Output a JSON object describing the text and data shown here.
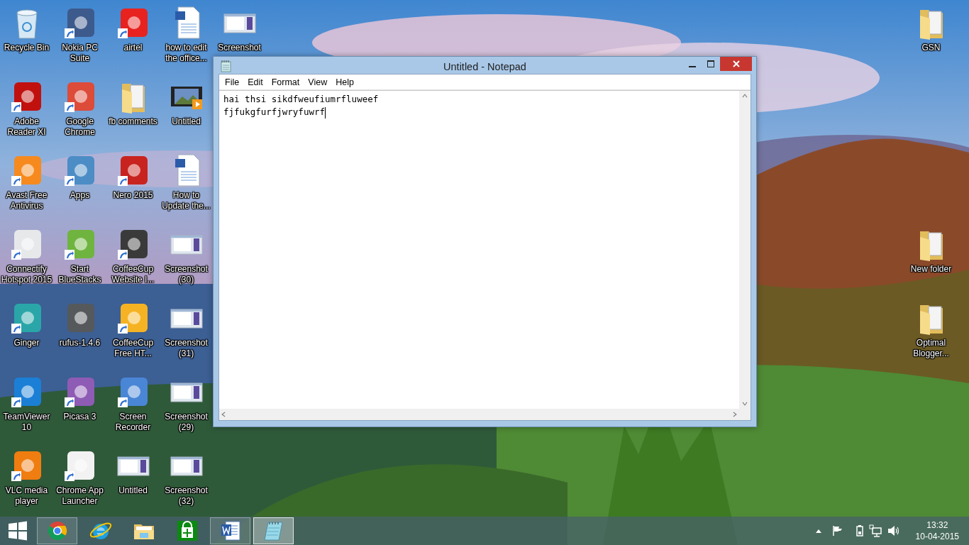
{
  "desktop": {
    "icon_columns": [
      [
        {
          "label": "Recycle Bin",
          "kind": "bin",
          "shortcut": false
        },
        {
          "label": "Adobe Reader XI",
          "kind": "app",
          "color": "#c1110f",
          "shortcut": true
        },
        {
          "label": "Avast Free Antivirus",
          "kind": "app",
          "color": "#f68a1e",
          "shortcut": true
        },
        {
          "label": "Connectify Hotspot 2015",
          "kind": "app",
          "color": "#e6e8ea",
          "shortcut": true
        },
        {
          "label": "Ginger",
          "kind": "app",
          "color": "#2aa6a8",
          "shortcut": true
        },
        {
          "label": "TeamViewer 10",
          "kind": "app",
          "color": "#1b7fd6",
          "shortcut": true
        },
        {
          "label": "VLC media player",
          "kind": "app",
          "color": "#f07d10",
          "shortcut": true
        }
      ],
      [
        {
          "label": "Nokia PC Suite",
          "kind": "app",
          "color": "#3d5a8c",
          "shortcut": true
        },
        {
          "label": "Google Chrome",
          "kind": "app",
          "color": "#dd4b39",
          "shortcut": true
        },
        {
          "label": "Apps",
          "kind": "app",
          "color": "#4c8dc6",
          "shortcut": true
        },
        {
          "label": "Start BlueStacks",
          "kind": "app",
          "color": "#6fb43f",
          "shortcut": true
        },
        {
          "label": "rufus-1.4.6",
          "kind": "app",
          "color": "#55595c",
          "shortcut": false
        },
        {
          "label": "Picasa 3",
          "kind": "app",
          "color": "#8e5bb5",
          "shortcut": true
        },
        {
          "label": "Chrome App Launcher",
          "kind": "app",
          "color": "#f2f2f2",
          "shortcut": true
        }
      ],
      [
        {
          "label": "airtel",
          "kind": "app",
          "color": "#e8221f",
          "shortcut": true
        },
        {
          "label": "fb comments",
          "kind": "folder",
          "shortcut": false
        },
        {
          "label": "Nero 2015",
          "kind": "app",
          "color": "#c8231e",
          "shortcut": true
        },
        {
          "label": "CoffeeCup Website I...",
          "kind": "app",
          "color": "#3a3a3a",
          "shortcut": true
        },
        {
          "label": "CoffeeCup Free HT...",
          "kind": "app",
          "color": "#f5b323",
          "shortcut": true
        },
        {
          "label": "Screen Recorder",
          "kind": "app",
          "color": "#4a86d6",
          "shortcut": true
        },
        {
          "label": "Untitled",
          "kind": "thumbnail",
          "shortcut": false
        }
      ],
      [
        {
          "label": "how to edit the office...",
          "kind": "document",
          "shortcut": false
        },
        {
          "label": "Untitled",
          "kind": "video",
          "shortcut": false
        },
        {
          "label": "How to Update the...",
          "kind": "document",
          "shortcut": false
        },
        {
          "label": "Screenshot (30)",
          "kind": "thumbnail",
          "shortcut": false
        },
        {
          "label": "Screenshot (31)",
          "kind": "thumbnail",
          "shortcut": false
        },
        {
          "label": "Screenshot (29)",
          "kind": "thumbnail",
          "shortcut": false
        },
        {
          "label": "Screenshot (32)",
          "kind": "thumbnail",
          "shortcut": false
        }
      ],
      [
        {
          "label": "Screenshot",
          "kind": "thumbnail",
          "shortcut": false
        }
      ]
    ],
    "right_icons": [
      {
        "label": "GSN",
        "kind": "folder",
        "shortcut": false
      },
      {
        "label": "New folder",
        "kind": "folder",
        "shortcut": false
      },
      {
        "label": "Optimal Blogger...",
        "kind": "folder",
        "shortcut": false
      }
    ]
  },
  "notepad": {
    "title": "Untitled - Notepad",
    "menu": [
      "File",
      "Edit",
      "Format",
      "View",
      "Help"
    ],
    "lines": [
      "hai thsi sikdfweufiumrfluweef",
      "fjfukgfurfjwryfuwrf"
    ]
  },
  "taskbar": {
    "items": [
      {
        "kind": "start",
        "running": false,
        "selected": false
      },
      {
        "kind": "chrome",
        "running": true,
        "selected": false
      },
      {
        "kind": "ie",
        "running": false,
        "selected": false
      },
      {
        "kind": "explorer",
        "running": false,
        "selected": false
      },
      {
        "kind": "store",
        "running": false,
        "selected": false
      },
      {
        "kind": "word",
        "running": true,
        "selected": false
      },
      {
        "kind": "notepad",
        "running": true,
        "selected": true
      }
    ],
    "clock": {
      "time": "13:32",
      "date": "10-04-2015"
    }
  }
}
